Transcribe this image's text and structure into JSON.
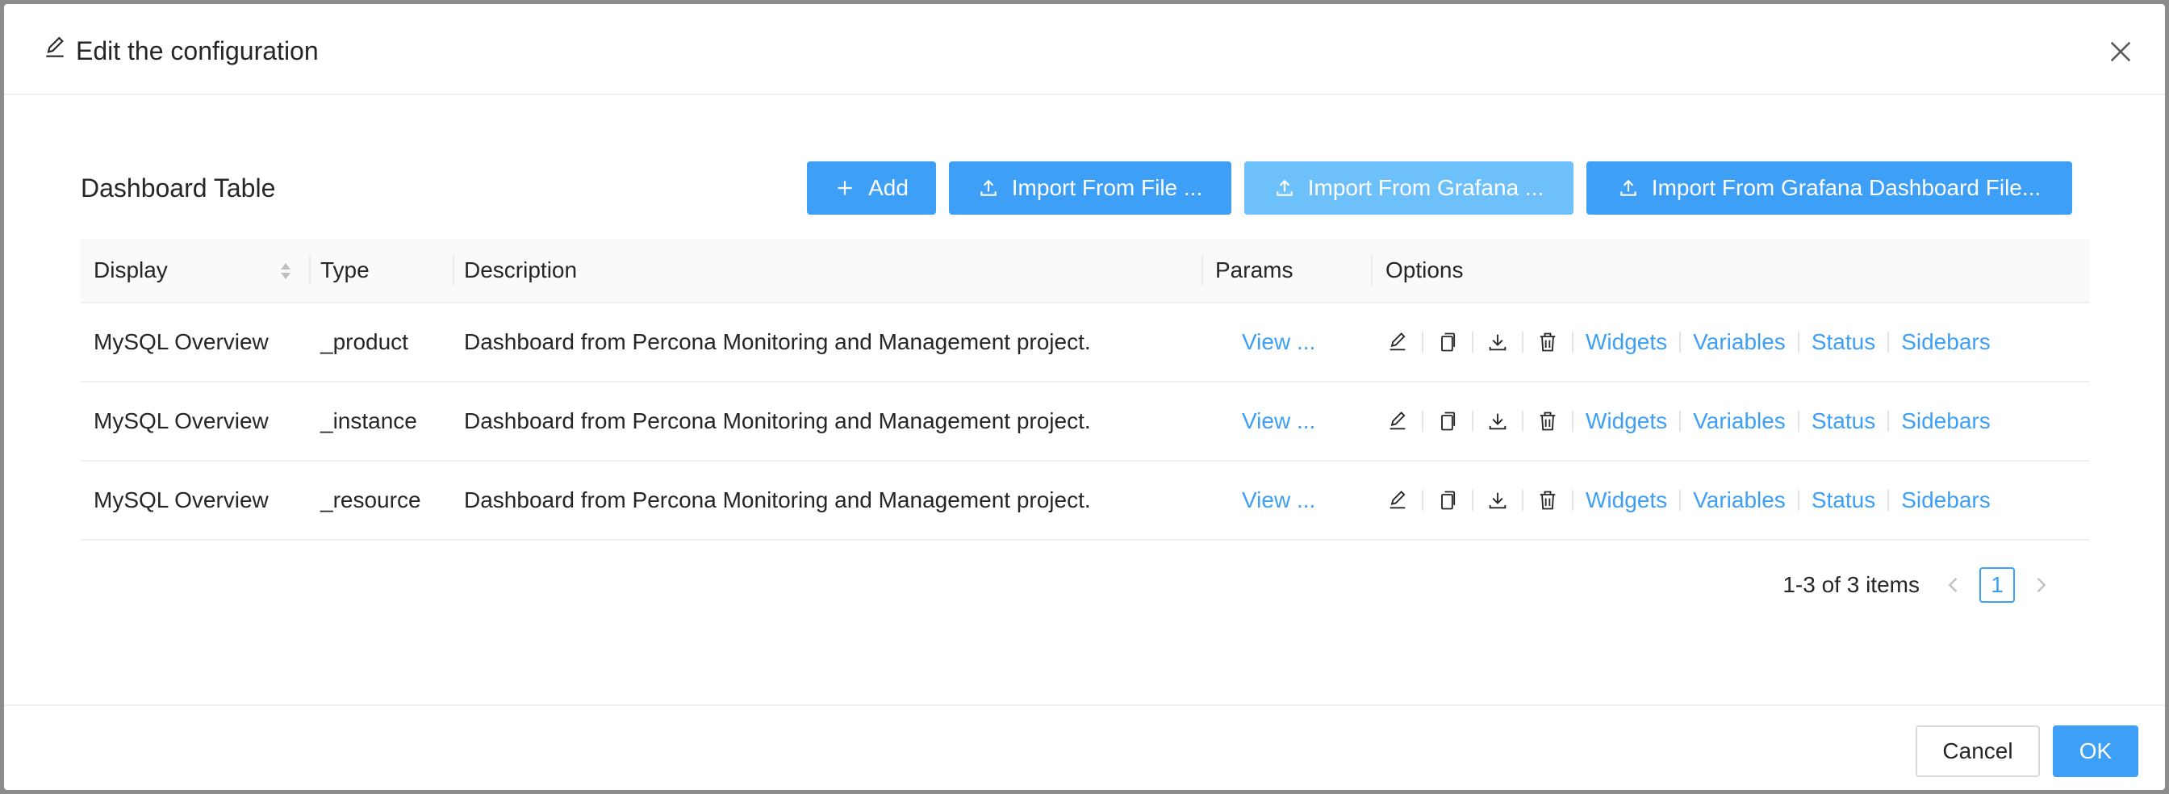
{
  "modal": {
    "title": "Edit the configuration",
    "close_icon": "close-icon",
    "cancel_label": "Cancel",
    "ok_label": "OK"
  },
  "toolbar": {
    "title": "Dashboard Table",
    "add_label": "Add",
    "import_file_label": "Import From File ...",
    "import_grafana_label": "Import From Grafana ...",
    "import_grafana_file_label": "Import From Grafana Dashboard File..."
  },
  "table": {
    "columns": [
      "Display",
      "Type",
      "Description",
      "Params",
      "Options"
    ],
    "rows": [
      {
        "display": "MySQL Overview",
        "type": "_product",
        "description": "Dashboard from Percona Monitoring and Management project.",
        "params": "View ..."
      },
      {
        "display": "MySQL Overview",
        "type": "_instance",
        "description": "Dashboard from Percona Monitoring and Management project.",
        "params": "View ..."
      },
      {
        "display": "MySQL Overview",
        "type": "_resource",
        "description": "Dashboard from Percona Monitoring and Management project.",
        "params": "View ..."
      }
    ],
    "option_icons": [
      "edit-icon",
      "copy-icon",
      "download-icon",
      "delete-icon"
    ],
    "option_links": [
      "Widgets",
      "Variables",
      "Status",
      "Sidebars"
    ]
  },
  "pagination": {
    "summary": "1-3 of 3 items",
    "current_page": "1"
  },
  "colors": {
    "primary": "#3d9ff6",
    "primary_light": "#6ec0fb"
  }
}
